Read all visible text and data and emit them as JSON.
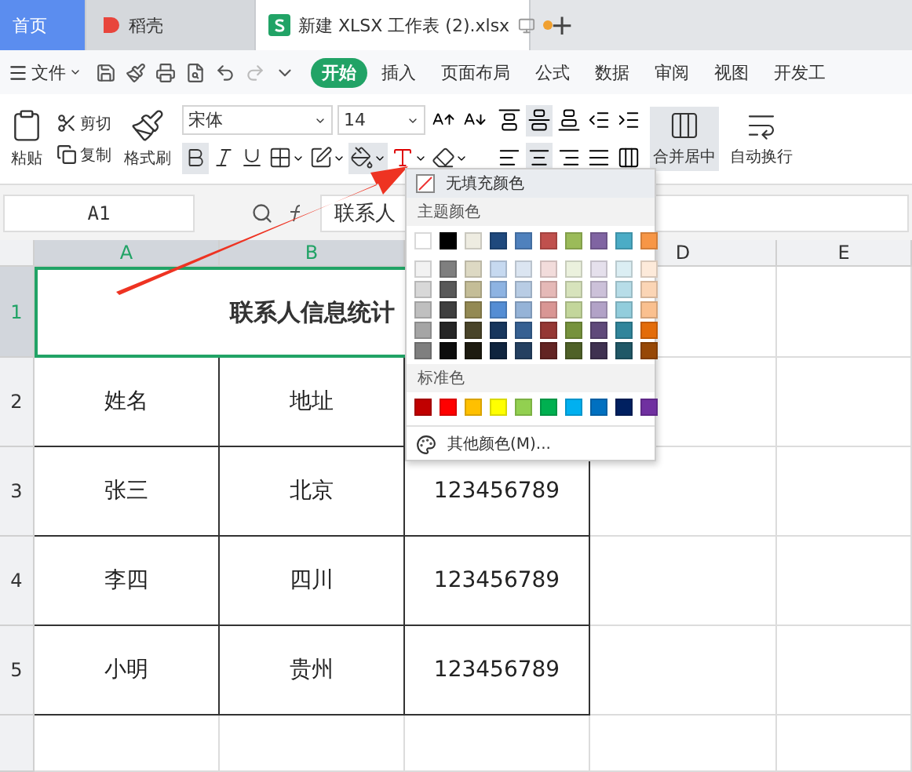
{
  "tabs": [
    {
      "label": "首页",
      "kind": "home",
      "selected": false
    },
    {
      "label": "稻壳",
      "kind": "docer",
      "selected": false
    },
    {
      "label": "新建 XLSX 工作表 (2).xlsx",
      "kind": "sheet",
      "selected": true
    }
  ],
  "new_tab": "+",
  "menu": {
    "file": "文件",
    "items": [
      {
        "label": "开始",
        "selected": true
      },
      {
        "label": "插入",
        "selected": false
      },
      {
        "label": "页面布局",
        "selected": false
      },
      {
        "label": "公式",
        "selected": false
      },
      {
        "label": "数据",
        "selected": false
      },
      {
        "label": "审阅",
        "selected": false
      },
      {
        "label": "视图",
        "selected": false
      },
      {
        "label": "开发工",
        "selected": false
      }
    ]
  },
  "ribbon": {
    "paste": "粘贴",
    "cut": "剪切",
    "copy": "复制",
    "format_painter": "格式刷",
    "font": "宋体",
    "font_size": "14",
    "font_buttons": [
      {
        "kind": "bold",
        "active": true
      },
      {
        "kind": "italic",
        "active": false
      },
      {
        "kind": "underline",
        "active": false
      },
      {
        "kind": "border",
        "active": false
      },
      {
        "kind": "style",
        "active": false
      },
      {
        "kind": "fill",
        "active": true
      },
      {
        "kind": "fontcolor",
        "active": false
      },
      {
        "kind": "clear",
        "active": false
      }
    ],
    "align_top": [
      {
        "kind": "top",
        "active": false
      },
      {
        "kind": "middle",
        "active": true
      },
      {
        "kind": "bottom",
        "active": false
      },
      {
        "kind": "outdent",
        "active": false
      },
      {
        "kind": "indent",
        "active": false
      }
    ],
    "align_bottom": [
      {
        "kind": "left",
        "active": false
      },
      {
        "kind": "center",
        "active": true
      },
      {
        "kind": "right",
        "active": false
      },
      {
        "kind": "justify",
        "active": false
      },
      {
        "kind": "distribute",
        "active": false
      }
    ],
    "merge": "合并居中",
    "wrap": "自动换行"
  },
  "formula_bar": {
    "cell": "A1",
    "content": "联系人"
  },
  "sheet": {
    "columns": [
      "A",
      "B",
      "D",
      "E"
    ],
    "rows": [
      "1",
      "2",
      "3",
      "4",
      "5"
    ],
    "title": "联系人信息统计",
    "cells": [
      [
        "姓名",
        "地址"
      ],
      [
        "张三",
        "北京",
        "123456789"
      ],
      [
        "李四",
        "四川",
        "123456789"
      ],
      [
        "小明",
        "贵州",
        "123456789"
      ]
    ]
  },
  "fill_menu": {
    "no_fill": "无填充颜色",
    "theme_label": "主题颜色",
    "standard_label": "标准色",
    "more": "其他颜色(M)...",
    "theme": [
      {
        "color": "#ffffff"
      },
      {
        "color": "#000000"
      },
      {
        "color": "#eeece1"
      },
      {
        "color": "#1f497d"
      },
      {
        "color": "#4f81bd"
      },
      {
        "color": "#c0504d"
      },
      {
        "color": "#9bbb59"
      },
      {
        "color": "#8064a2"
      },
      {
        "color": "#4bacc6"
      },
      {
        "color": "#f79646"
      }
    ],
    "shades": [
      [
        {
          "color": "#f2f2f2"
        },
        {
          "color": "#7f7f7f"
        },
        {
          "color": "#ddd9c3"
        },
        {
          "color": "#c6d9f0"
        },
        {
          "color": "#dbe5f1"
        },
        {
          "color": "#f2dcdb"
        },
        {
          "color": "#ebf1dd"
        },
        {
          "color": "#e5e0ec"
        },
        {
          "color": "#dbeef3"
        },
        {
          "color": "#fdeada"
        }
      ],
      [
        {
          "color": "#d8d8d8"
        },
        {
          "color": "#595959"
        },
        {
          "color": "#c4bd97"
        },
        {
          "color": "#8db3e2"
        },
        {
          "color": "#b8cce4"
        },
        {
          "color": "#e5b9b7"
        },
        {
          "color": "#d7e3bc"
        },
        {
          "color": "#ccc1d9"
        },
        {
          "color": "#b7dde8"
        },
        {
          "color": "#fbd5b5"
        }
      ],
      [
        {
          "color": "#bfbfbf"
        },
        {
          "color": "#3f3f3f"
        },
        {
          "color": "#938953"
        },
        {
          "color": "#548dd4"
        },
        {
          "color": "#95b3d7"
        },
        {
          "color": "#d99694"
        },
        {
          "color": "#c3d69b"
        },
        {
          "color": "#b2a2c7"
        },
        {
          "color": "#92cddc"
        },
        {
          "color": "#fac08f"
        }
      ],
      [
        {
          "color": "#a5a5a5"
        },
        {
          "color": "#262626"
        },
        {
          "color": "#494429"
        },
        {
          "color": "#17365d"
        },
        {
          "color": "#366092"
        },
        {
          "color": "#953734"
        },
        {
          "color": "#76923c"
        },
        {
          "color": "#5f497a"
        },
        {
          "color": "#31859b"
        },
        {
          "color": "#e36c09"
        }
      ],
      [
        {
          "color": "#7f7f7f"
        },
        {
          "color": "#0c0c0c"
        },
        {
          "color": "#1d1b10"
        },
        {
          "color": "#0f243e"
        },
        {
          "color": "#244061"
        },
        {
          "color": "#632423"
        },
        {
          "color": "#4f6128"
        },
        {
          "color": "#3f3151"
        },
        {
          "color": "#205867"
        },
        {
          "color": "#974806"
        }
      ]
    ],
    "standard": [
      {
        "color": "#c00000"
      },
      {
        "color": "#ff0000"
      },
      {
        "color": "#ffc000"
      },
      {
        "color": "#ffff00"
      },
      {
        "color": "#92d050"
      },
      {
        "color": "#00b050"
      },
      {
        "color": "#00b0f0"
      },
      {
        "color": "#0070c0"
      },
      {
        "color": "#002060"
      },
      {
        "color": "#7030a0"
      }
    ]
  }
}
